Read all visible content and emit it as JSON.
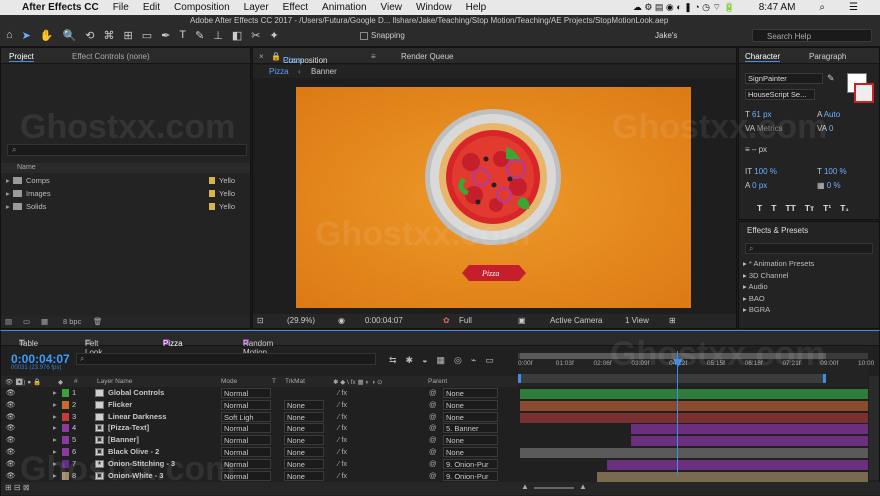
{
  "menubar": {
    "apple": "",
    "items": [
      "After Effects CC",
      "File",
      "Edit",
      "Composition",
      "Layer",
      "Effect",
      "Animation",
      "View",
      "Window",
      "Help"
    ],
    "time": "8:47 AM"
  },
  "window_title": "Adobe After Effects CC 2017 - /Users/Futura/Google D... llshare/Jake/Teaching/Stop Motion/Teaching/AE Projects/StopMotionLook.aep",
  "toolbar": {
    "snapping": "Snapping",
    "workspace": "Jake's",
    "search": "Search Help"
  },
  "project_panel": {
    "tabs": [
      "Project",
      "Effect Controls (none)"
    ],
    "column_header": "Name",
    "items": [
      {
        "name": "Comps",
        "label": "Yello"
      },
      {
        "name": "Images",
        "label": "Yello"
      },
      {
        "name": "Solids",
        "label": "Yello"
      }
    ],
    "bpc": "8 bpc"
  },
  "comp_panel": {
    "tab_prefix": "Composition",
    "tab_name": "Pizza",
    "render_queue": "Render Queue",
    "breadcrumbs": [
      "Pizza",
      "Banner"
    ],
    "zoom": "(29.9%)",
    "timecode": "0:00:04:07",
    "resolution": "Full",
    "camera": "Active Camera",
    "views": "1 View",
    "banner_text": "Pizza"
  },
  "character_panel": {
    "tabs": [
      "Character",
      "Paragraph"
    ],
    "font": "SignPainter",
    "style": "HouseScript Se...",
    "size": "61 px",
    "leading": "Auto",
    "kerning": "Metrics",
    "tracking": "0",
    "stroke": "– px",
    "vscale": "100 %",
    "hscale": "100 %",
    "baseline": "0 px",
    "tsume": "0 %",
    "style_buttons": [
      "T",
      "T",
      "TT",
      "Tт",
      "T¹",
      "T₁"
    ]
  },
  "effects_panel": {
    "title": "Effects & Presets",
    "items": [
      "* Animation Presets",
      "3D Channel",
      "Audio",
      "BAO",
      "BGRA"
    ]
  },
  "timeline": {
    "tabs": [
      "Table",
      "Felt Look",
      "Pizza",
      "Random Motion"
    ],
    "timecode": "0:00:04:07",
    "sub_timecode": "00031 (23.976 fps)",
    "columns": {
      "layer_name": "Layer Name",
      "mode": "Mode",
      "t": "T",
      "trkmat": "TrkMat",
      "parent": "Parent"
    },
    "ruler": [
      "0:00f",
      "01:03f",
      "02:06f",
      "03:09f",
      "04:12f",
      "05:15f",
      "06:18f",
      "07:21f",
      "09:00f",
      "10:00"
    ],
    "layers": [
      {
        "num": "1",
        "name": "Global Controls",
        "mode": "Normal",
        "trkmat": "",
        "parent": "None",
        "color": "#3da23d",
        "bar_color": "#2e7d3a",
        "bar_start": 0,
        "bar_end": 1,
        "type": "solid"
      },
      {
        "num": "2",
        "name": "Flicker",
        "mode": "Normal",
        "trkmat": "None",
        "parent": "None",
        "color": "#c86a2a",
        "bar_color": "#8a4a2e",
        "bar_start": 0,
        "bar_end": 1,
        "type": "solid"
      },
      {
        "num": "3",
        "name": "Linear Darkness",
        "mode": "Soft Ligh",
        "trkmat": "None",
        "parent": "None",
        "color": "#c83a3a",
        "bar_color": "#7a3030",
        "bar_start": 0,
        "bar_end": 1,
        "type": "solid"
      },
      {
        "num": "4",
        "name": "[Pizza-Text]",
        "mode": "Normal",
        "trkmat": "None",
        "parent": "5. Banner",
        "color": "#8a3aa0",
        "bar_color": "#6b2f7d",
        "bar_start": 0.32,
        "bar_end": 1,
        "type": "comp"
      },
      {
        "num": "5",
        "name": "[Banner]",
        "mode": "Normal",
        "trkmat": "None",
        "parent": "None",
        "color": "#8a3aa0",
        "bar_color": "#6b2f7d",
        "bar_start": 0.32,
        "bar_end": 1,
        "type": "comp"
      },
      {
        "num": "6",
        "name": "Black Olive - 2",
        "mode": "Normal",
        "trkmat": "None",
        "parent": "None",
        "color": "#8a3aa0",
        "bar_color": "#5a5a5a",
        "bar_start": 0,
        "bar_end": 1,
        "type": "shape"
      },
      {
        "num": "7",
        "name": "Onion-Stitching - 3",
        "mode": "Normal",
        "trkmat": "None",
        "parent": "9. Onion-Pur",
        "color": "#6a2a8a",
        "bar_color": "#6b2f7d",
        "bar_start": 0.25,
        "bar_end": 1,
        "type": "star"
      },
      {
        "num": "8",
        "name": "Onion-White - 3",
        "mode": "Normal",
        "trkmat": "None",
        "parent": "9. Onion-Pur",
        "color": "#a08a6a",
        "bar_color": "#7a6a50",
        "bar_start": 0.22,
        "bar_end": 1,
        "type": "comp"
      }
    ]
  },
  "watermark": "Ghostxx.com",
  "colors": {
    "accent": "#3a8ee6",
    "orange_bg": "#e88a1c"
  }
}
